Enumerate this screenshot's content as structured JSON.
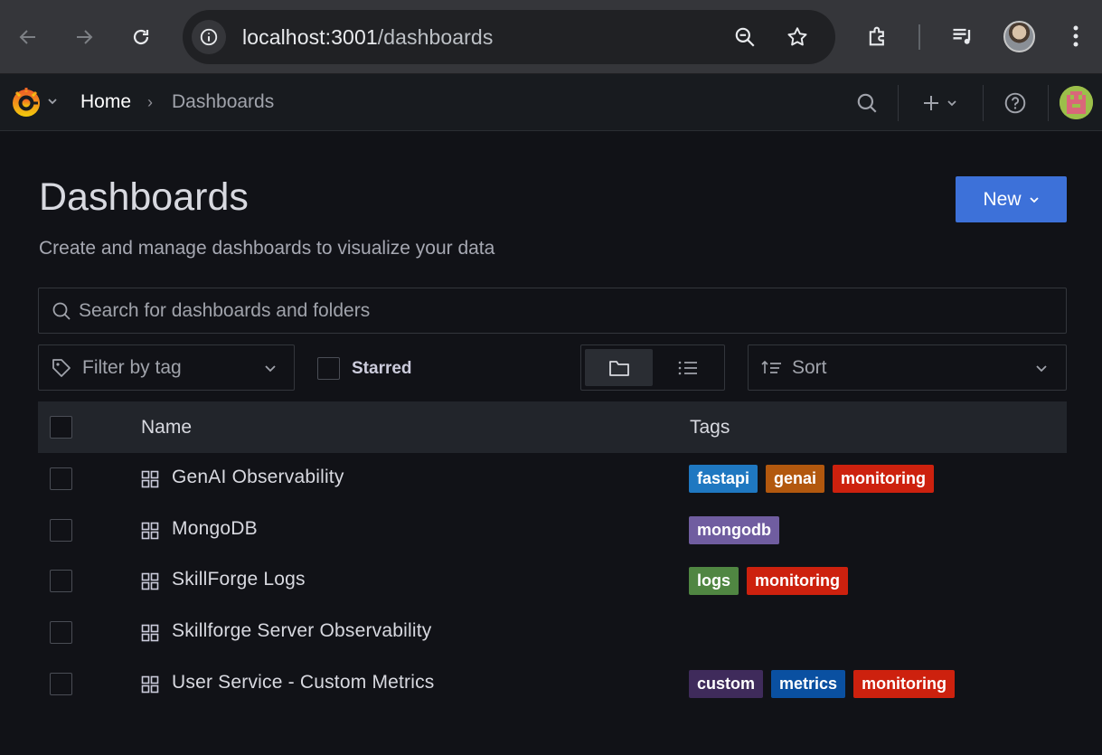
{
  "browser": {
    "url_host": "localhost:3001",
    "url_path": "/dashboards"
  },
  "breadcrumb": {
    "home": "Home",
    "separator": "›",
    "current": "Dashboards"
  },
  "page": {
    "title": "Dashboards",
    "subtitle": "Create and manage dashboards to visualize your data",
    "new_button": "New"
  },
  "search": {
    "placeholder": "Search for dashboards and folders"
  },
  "filters": {
    "tag_filter": "Filter by tag",
    "starred": "Starred",
    "sort": "Sort"
  },
  "table": {
    "columns": {
      "name": "Name",
      "tags": "Tags"
    },
    "rows": [
      {
        "name": "GenAI Observability",
        "tags": [
          {
            "label": "fastapi",
            "color": "#1f78c1"
          },
          {
            "label": "genai",
            "color": "#b2580e"
          },
          {
            "label": "monitoring",
            "color": "#cd210e"
          }
        ]
      },
      {
        "name": "MongoDB",
        "tags": [
          {
            "label": "mongodb",
            "color": "#705da0"
          }
        ]
      },
      {
        "name": "SkillForge Logs",
        "tags": [
          {
            "label": "logs",
            "color": "#508642"
          },
          {
            "label": "monitoring",
            "color": "#cd210e"
          }
        ]
      },
      {
        "name": "Skillforge Server Observability",
        "tags": []
      },
      {
        "name": "User Service - Custom Metrics",
        "tags": [
          {
            "label": "custom",
            "color": "#3f2b5b"
          },
          {
            "label": "metrics",
            "color": "#0a50a1"
          },
          {
            "label": "monitoring",
            "color": "#cd210e"
          }
        ]
      }
    ]
  },
  "colors": {
    "primary": "#3d71d9",
    "background": "#111217",
    "topbar": "#181b1f"
  }
}
